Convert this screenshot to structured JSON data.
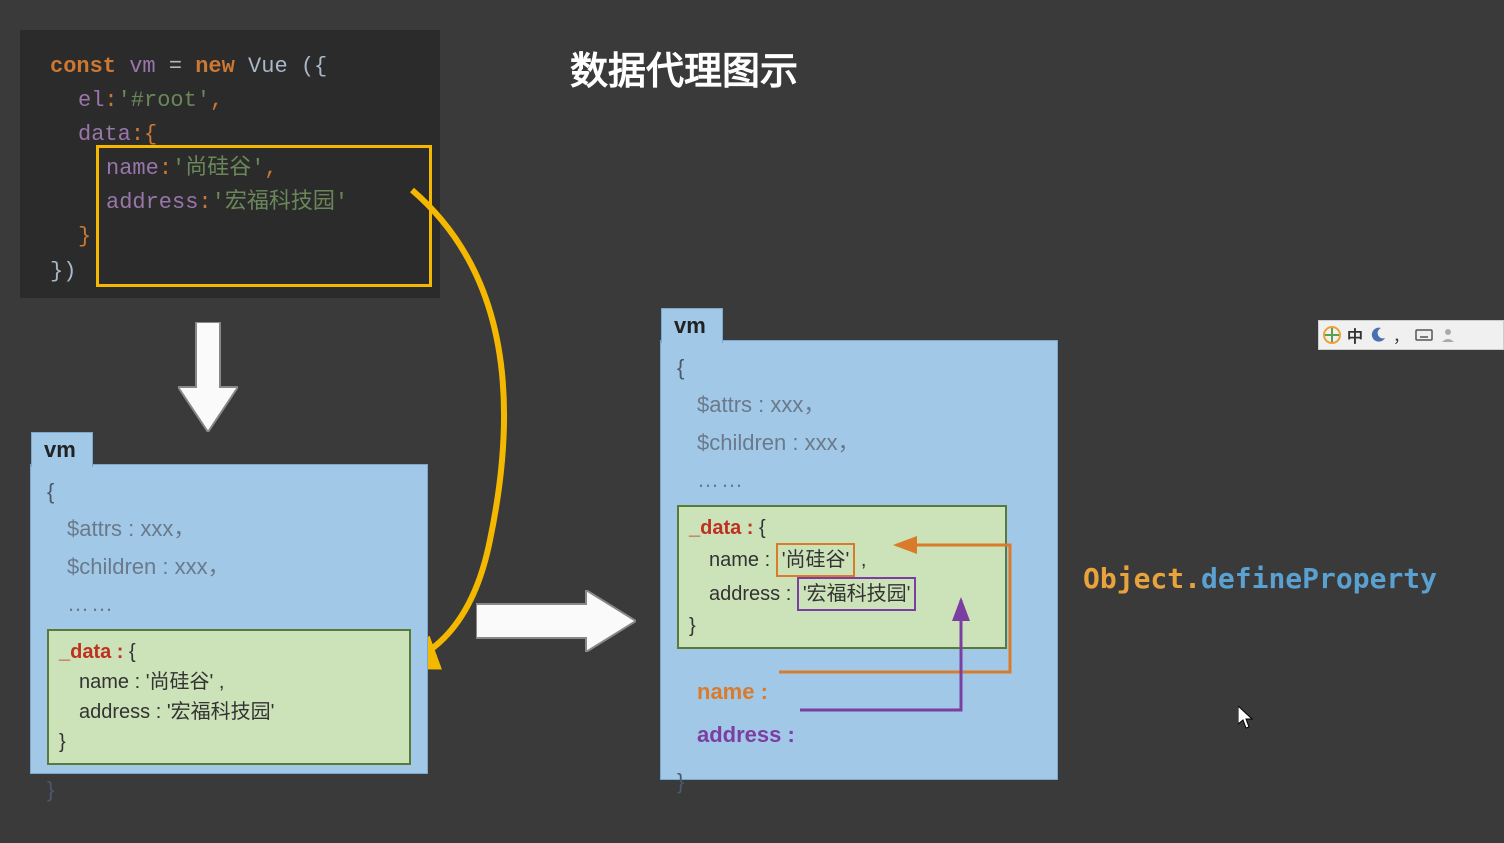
{
  "title": "数据代理图示",
  "code": {
    "const": "const",
    "vm": "vm",
    "eq": "=",
    "new": "new",
    "vue": "Vue",
    "lbrace": "({",
    "el_key": "el",
    "el_val": "'#root'",
    "data_key": "data",
    "name_key": "name",
    "name_val": "'尚硅谷'",
    "address_key": "address",
    "address_val": "'宏福科技园'",
    "rbrace": "})"
  },
  "vm1": {
    "tab": "vm",
    "lbrace": "{",
    "attrs": "$attrs : xxx，",
    "children": "$children : xxx，",
    "dots": "……",
    "data_label": "_data : ",
    "data_lbrace": "{",
    "name_line": "name : '尚硅谷' ,",
    "address_line": "address : '宏福科技园'",
    "data_rbrace": "}",
    "rbrace": "}"
  },
  "vm2": {
    "tab": "vm",
    "lbrace": "{",
    "attrs": "$attrs : xxx，",
    "children": "$children : xxx，",
    "dots": "……",
    "data_label": "_data : ",
    "data_lbrace": "{",
    "name_key": "name :",
    "name_val": "'尚硅谷'",
    "name_comma": " ,",
    "address_key": "address :",
    "address_val": "'宏福科技园'",
    "data_rbrace": "}",
    "name_prop": "name :",
    "address_prop": "address :",
    "rbrace": "}"
  },
  "odp": {
    "object": "Object",
    "dot": ".",
    "method": "defineProperty"
  },
  "ime": {
    "char": "中",
    "punct": "，"
  }
}
